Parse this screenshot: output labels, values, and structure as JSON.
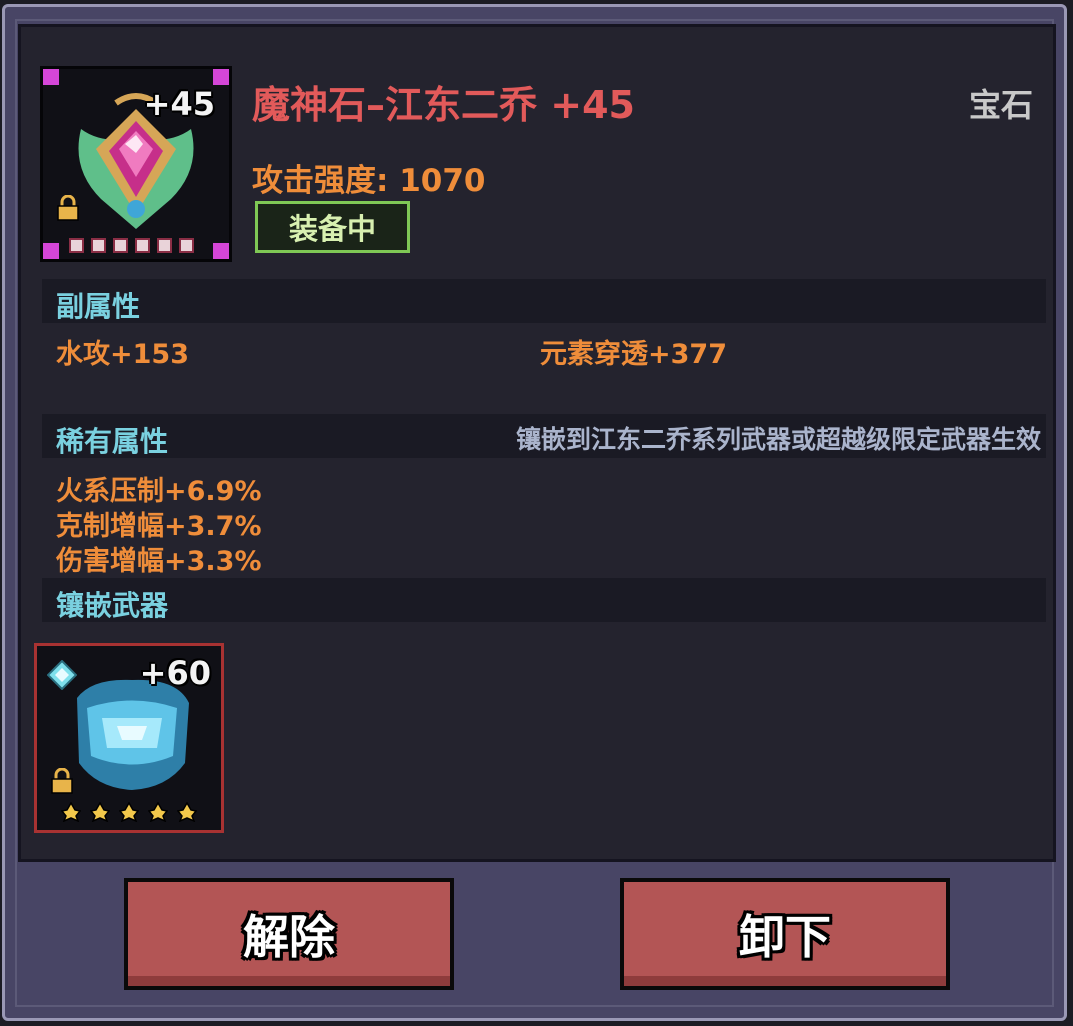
{
  "item": {
    "name": "魔神石–江东二乔 +45",
    "type": "宝石",
    "level_badge": "+45",
    "attack": "攻击强度: 1070",
    "equipped": "装备中",
    "star_count": 6
  },
  "sub_attributes": {
    "label": "副属性",
    "stats": [
      "水攻+153",
      "元素穿透+377"
    ]
  },
  "rare_attributes": {
    "label": "稀有属性",
    "note": "镶嵌到江东二乔系列武器或超越级限定武器生效",
    "stats": [
      "火系压制+6.9%",
      "克制增幅+3.7%",
      "伤害增幅+3.3%"
    ]
  },
  "inlay_weapon": {
    "label": "镶嵌武器",
    "level_badge": "+60",
    "star_count": 5
  },
  "buttons": {
    "remove": "解除",
    "unequip": "卸下"
  },
  "colors": {
    "title": "#e25a5a",
    "stat": "#ef8d3a",
    "section_label": "#7ad1e0",
    "equipped_border": "#7fc855",
    "button": "#b35555"
  }
}
